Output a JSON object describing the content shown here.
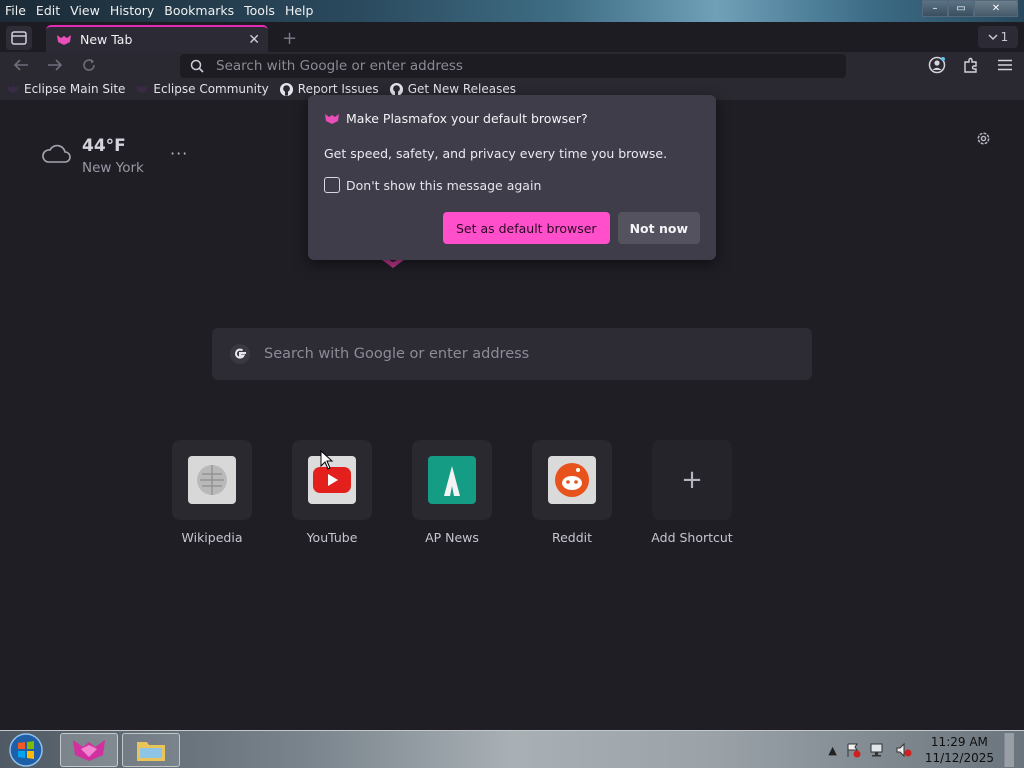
{
  "menu": [
    "File",
    "Edit",
    "View",
    "History",
    "Bookmarks",
    "Tools",
    "Help"
  ],
  "window_controls": {
    "minimize": "–",
    "maximize": "▭",
    "close": "✕"
  },
  "tab": {
    "title": "New Tab",
    "close": "✕"
  },
  "new_tab_symbol": "+",
  "tab_count": "1",
  "urlbar": {
    "placeholder": "Search with Google or enter address"
  },
  "bookmarks": [
    {
      "label": "Eclipse Main Site",
      "icon": "plasmafox-icon"
    },
    {
      "label": "Eclipse Community",
      "icon": "plasmafox-icon"
    },
    {
      "label": "Report Issues",
      "icon": "github-icon"
    },
    {
      "label": "Get New Releases",
      "icon": "github-icon"
    }
  ],
  "weather": {
    "temp": "44°F",
    "city": "New York",
    "more": "···"
  },
  "search": {
    "placeholder": "Search with Google or enter address"
  },
  "shortcuts": [
    {
      "label": "Wikipedia",
      "icon": "wikipedia-icon"
    },
    {
      "label": "YouTube",
      "icon": "youtube-icon"
    },
    {
      "label": "AP News",
      "icon": "apnews-icon"
    },
    {
      "label": "Reddit",
      "icon": "reddit-icon"
    },
    {
      "label": "Add Shortcut",
      "icon": "plus-icon",
      "symbol": "+"
    }
  ],
  "popup": {
    "title": "Make Plasmafox your default browser?",
    "body": "Get speed, safety, and privacy every time you browse.",
    "checkbox_label": "Don't show this message again",
    "primary_button": "Set as default browser",
    "secondary_button": "Not now"
  },
  "taskbar": {
    "time": "11:29 AM",
    "date": "11/12/2025"
  },
  "colors": {
    "accent": "#ff4fcb",
    "background": "#1f1e25",
    "popup": "#403d4a"
  }
}
